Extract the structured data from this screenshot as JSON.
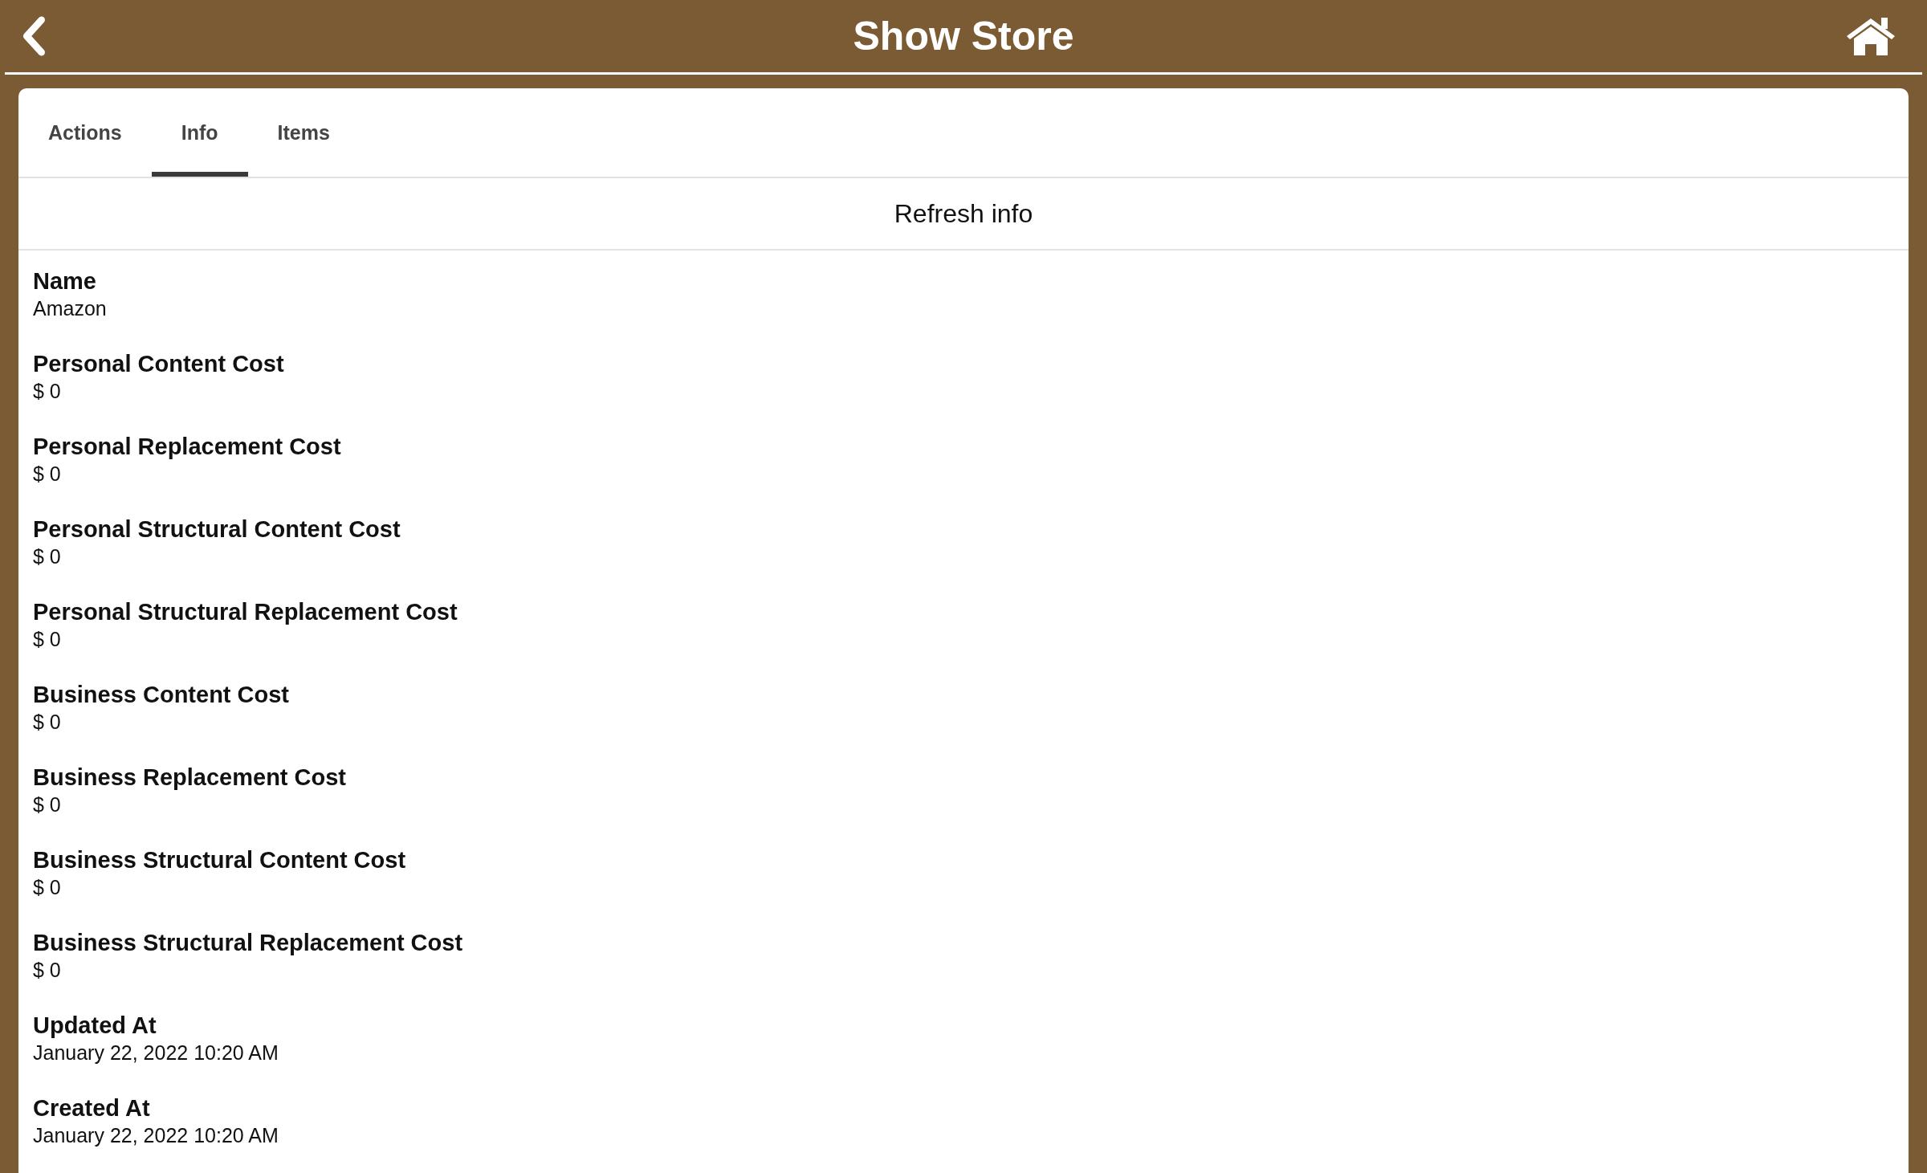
{
  "header": {
    "title": "Show Store"
  },
  "tabs": [
    {
      "label": "Actions",
      "selected": false
    },
    {
      "label": "Info",
      "selected": true
    },
    {
      "label": "Items",
      "selected": false
    }
  ],
  "refresh_button": "Refresh info",
  "fields": [
    {
      "label": "Name",
      "value": "Amazon"
    },
    {
      "label": "Personal Content Cost",
      "value": "$ 0"
    },
    {
      "label": "Personal Replacement Cost",
      "value": "$ 0"
    },
    {
      "label": "Personal Structural Content Cost",
      "value": "$ 0"
    },
    {
      "label": "Personal Structural Replacement Cost",
      "value": "$ 0"
    },
    {
      "label": "Business Content Cost",
      "value": "$ 0"
    },
    {
      "label": "Business Replacement Cost",
      "value": "$ 0"
    },
    {
      "label": "Business Structural Content Cost",
      "value": "$ 0"
    },
    {
      "label": "Business Structural Replacement Cost",
      "value": "$ 0"
    },
    {
      "label": "Updated At",
      "value": "January 22, 2022 10:20 AM"
    },
    {
      "label": "Created At",
      "value": "January 22, 2022 10:20 AM"
    }
  ]
}
